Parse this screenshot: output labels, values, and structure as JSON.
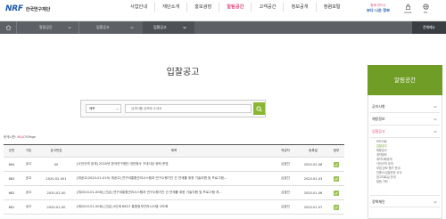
{
  "header": {
    "logo_mark": "NRF",
    "logo_text": "한국연구재단",
    "nav": [
      {
        "label": "사업안내",
        "active": false
      },
      {
        "label": "재단소개",
        "active": false
      },
      {
        "label": "홍보광장",
        "active": false
      },
      {
        "label": "알림공간",
        "active": true
      },
      {
        "label": "고객공간",
        "active": false
      },
      {
        "label": "정보공개",
        "active": false
      },
      {
        "label": "청렴포탈",
        "active": false
      }
    ],
    "badge_top": "함께 만드는",
    "badge_bottom": "보다 나은 정부",
    "login_label": "LOGIN",
    "en_label": "EN"
  },
  "subnav": {
    "items": [
      "알림공간",
      "입찰공고",
      "입찰공고"
    ],
    "sitemap": "전체메뉴"
  },
  "page_title": "입찰공고",
  "search": {
    "select_value": "제목",
    "placeholder": "검색어를 입력해 주세요"
  },
  "total": {
    "prefix": "총게시판:",
    "count": "684",
    "suffix": "/70Page"
  },
  "table": {
    "headers": [
      "순번",
      "구분",
      "공고번호",
      "제목",
      "작성자",
      "등록일",
      "첨부"
    ],
    "rows": [
      {
        "no": "684",
        "type": "공고",
        "notice_no": "00",
        "title": "[사전규격 공개] 2020년 한국연구재단 대전청사 구내식당 위탁 운영",
        "author": "심효진",
        "date": "2020.02.06",
        "attach": true
      },
      {
        "no": "683",
        "type": "공고",
        "notice_no": "2020-02-001",
        "title": "[재공고(2020-01-019) 재공고] 연구비통합관리시스템과 연구수행기관 간 연계를 위한 기술지원 및 프로그램...",
        "author": "심효진",
        "date": "2020.02.03",
        "attach": true
      },
      {
        "no": "682",
        "type": "공고",
        "notice_no": "2020-02-00",
        "title": "[재2020-01-008] [긴급] 연구비통합관리시스템과 연구수행기관 간 연계를 위한 기술지원 및 프로그램 개...",
        "author": "심효진",
        "date": "2020.01.06",
        "attach": true
      },
      {
        "no": "681",
        "type": "공고",
        "notice_no": "2020-01-00",
        "title": "[재2020-01-008] [긴급] 4단계 BK21 통합정보관리시스템 고도화",
        "author": "심효진",
        "date": "2020.01.07",
        "attach": true
      }
    ]
  },
  "sidebar": {
    "title": "알림공간",
    "items": [
      {
        "label": "공지사항",
        "active": false
      },
      {
        "label": "채용정보",
        "active": false
      },
      {
        "label": "입찰공고",
        "active": true
      }
    ],
    "sub_items": [
      {
        "label": "보도자료",
        "active": false
      },
      {
        "label": "입찰공고",
        "active": true
      },
      {
        "label": "채용공고",
        "active": false
      },
      {
        "label": "계약정보",
        "active": false
      },
      {
        "label": "계약사례공개",
        "active": false
      },
      {
        "label": "사전규격 공개",
        "active": false
      },
      {
        "label": "모집·공모·평가 안내",
        "active": false
      },
      {
        "label": "인증서·입찰관련 서식",
        "active": false
      },
      {
        "label": "참고자료실 안내",
        "active": false
      },
      {
        "label": "알림 기타",
        "active": false
      }
    ],
    "bottom_item": "정책제안"
  },
  "colors": {
    "accent_pink": "#e0457b",
    "accent_green": "#6f9d26",
    "subnav_bg": "#5d6166",
    "brand_blue": "#1d5aa8"
  }
}
